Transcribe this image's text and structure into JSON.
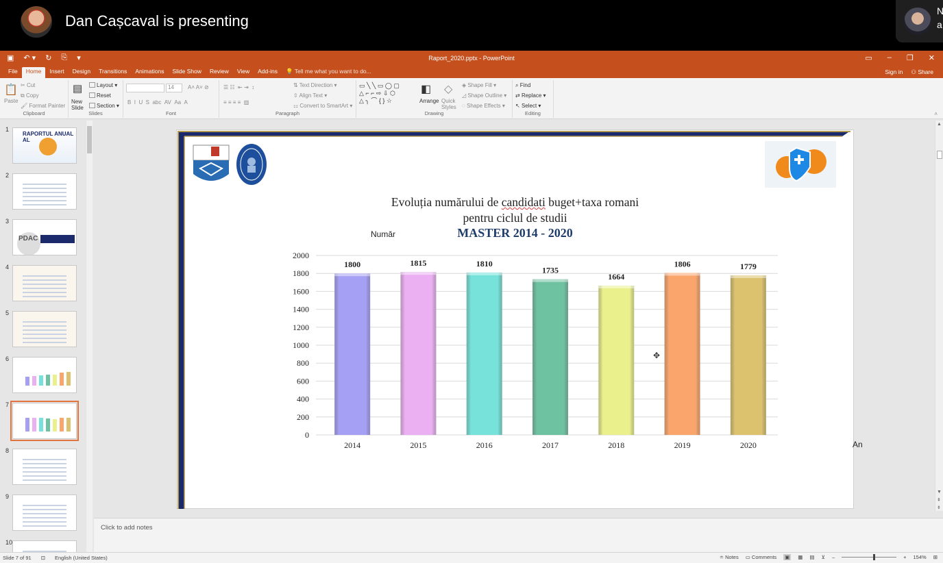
{
  "meeting": {
    "presenter": "Dan Cașcaval is presenting",
    "self_name": "N\na"
  },
  "window": {
    "title": "Raport_2020.pptx - PowerPoint",
    "sign_in": "Sign in",
    "share": "Share"
  },
  "tabs": [
    "File",
    "Home",
    "Insert",
    "Design",
    "Transitions",
    "Animations",
    "Slide Show",
    "Review",
    "View",
    "Add-ins"
  ],
  "active_tab": "Home",
  "tell_me": "Tell me what you want to do...",
  "ribbon": {
    "clipboard": {
      "label": "Clipboard",
      "paste": "Paste",
      "cut": "Cut",
      "copy": "Copy",
      "format_painter": "Format Painter"
    },
    "slides": {
      "label": "Slides",
      "new_slide": "New Slide",
      "layout": "Layout",
      "reset": "Reset",
      "section": "Section"
    },
    "font": {
      "label": "Font",
      "size": "14"
    },
    "paragraph": {
      "label": "Paragraph",
      "text_direction": "Text Direction",
      "align_text": "Align Text",
      "convert": "Convert to SmartArt"
    },
    "drawing": {
      "label": "Drawing",
      "arrange": "Arrange",
      "quick_styles": "Quick Styles",
      "shape_fill": "Shape Fill",
      "shape_outline": "Shape Outline",
      "shape_effects": "Shape Effects"
    },
    "editing": {
      "label": "Editing",
      "find": "Find",
      "replace": "Replace",
      "select": "Select"
    }
  },
  "thumbnails": [
    {
      "num": "1",
      "title": "RAPORTUL ANUAL AL"
    },
    {
      "num": "2",
      "title": ""
    },
    {
      "num": "3",
      "title": "PDAC"
    },
    {
      "num": "4",
      "title": ""
    },
    {
      "num": "5",
      "title": ""
    },
    {
      "num": "6",
      "title": ""
    },
    {
      "num": "7",
      "title": ""
    },
    {
      "num": "8",
      "title": ""
    },
    {
      "num": "9",
      "title": ""
    },
    {
      "num": "10",
      "title": ""
    }
  ],
  "active_slide": 7,
  "notes_placeholder": "Click to add notes",
  "status": {
    "slide_info": "Slide 7 of 91",
    "language": "English (United States)",
    "notes": "Notes",
    "comments": "Comments",
    "zoom": "154%"
  },
  "colors": {
    "accent": "#c5501e",
    "frame_navy": "#1b2a6b",
    "frame_gold": "#b59a52"
  },
  "chart_data": {
    "type": "bar",
    "title_line1": "Evoluția numărului de candidati buget+taxa romani",
    "title_line2": "pentru ciclul de studii",
    "title_line3": "MASTER 2014 - 2020",
    "ylabel": "Număr",
    "xlabel": "An",
    "categories": [
      "2014",
      "2015",
      "2016",
      "2017",
      "2018",
      "2019",
      "2020"
    ],
    "values": [
      1800,
      1815,
      1810,
      1735,
      1664,
      1806,
      1779
    ],
    "colors": [
      "#a6a0f4",
      "#eab0f2",
      "#76e2d9",
      "#6fc2a1",
      "#eaf08c",
      "#f9a56c",
      "#dcc26e"
    ],
    "ylim": [
      0,
      2000
    ],
    "yticks": [
      0,
      200,
      400,
      600,
      800,
      1000,
      1200,
      1400,
      1600,
      1800,
      2000
    ],
    "grid": true
  }
}
